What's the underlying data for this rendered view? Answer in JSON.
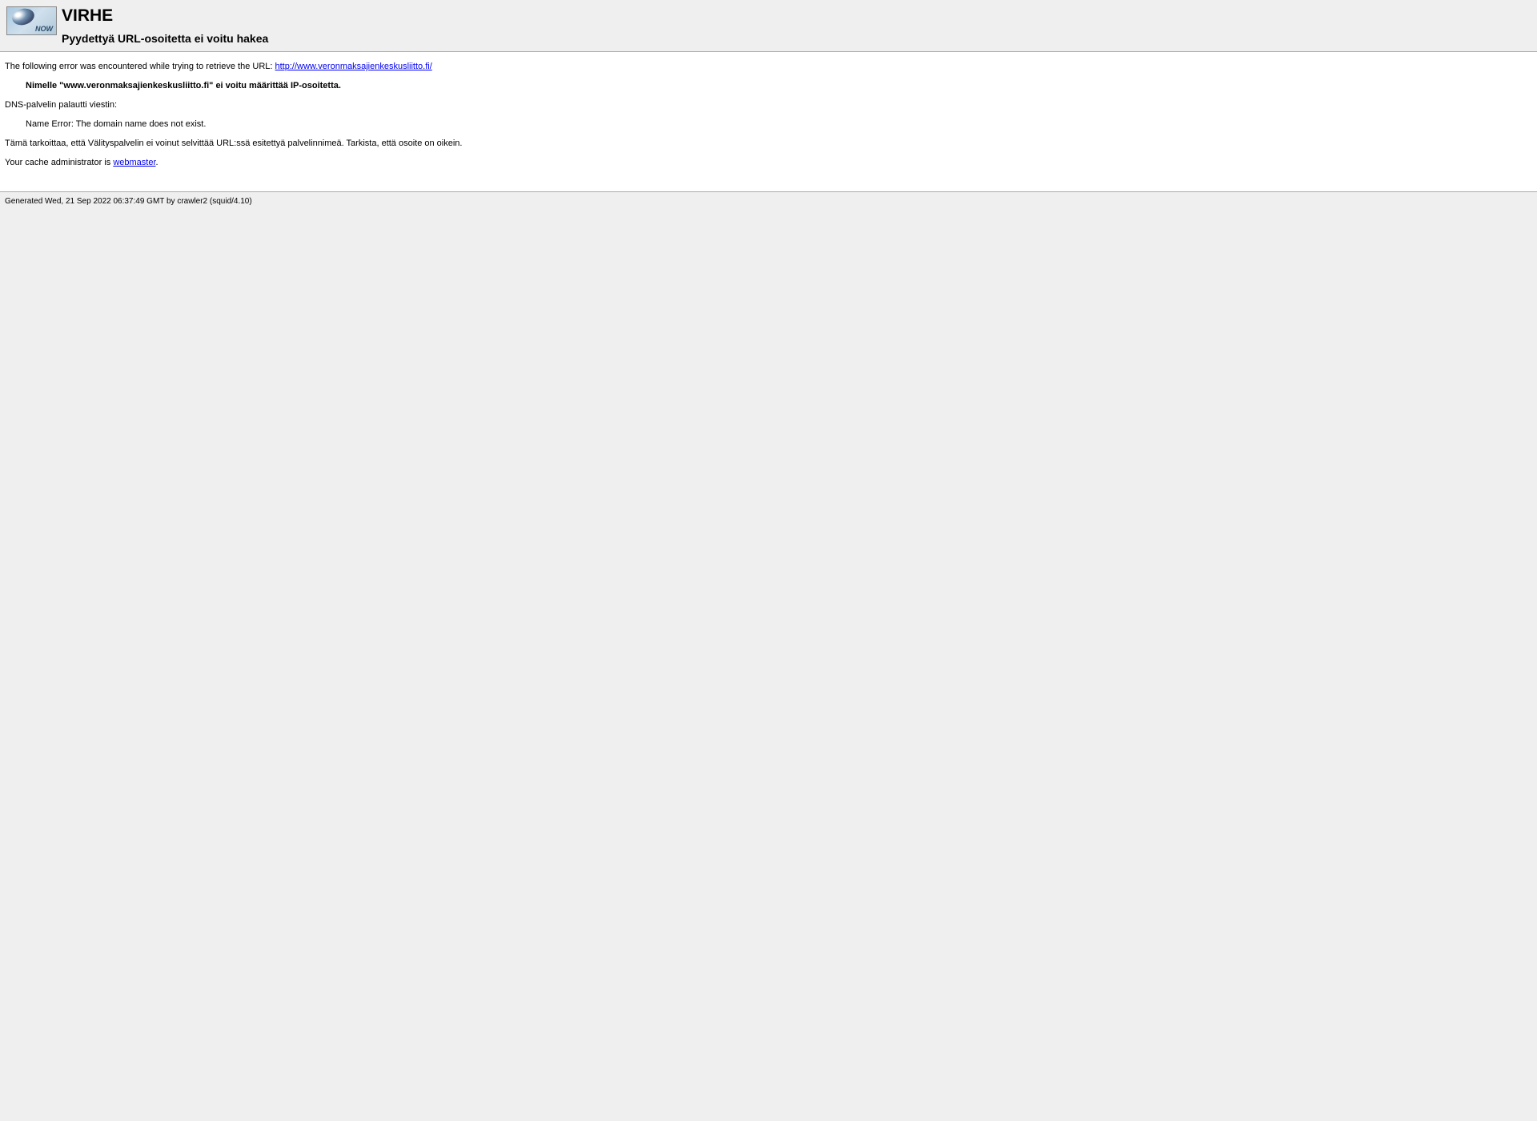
{
  "header": {
    "icon_label": "NOW",
    "title": "VIRHE",
    "subtitle": "Pyydettyä URL-osoitetta ei voitu hakea"
  },
  "content": {
    "intro_text": "The following error was encountered while trying to retrieve the URL: ",
    "url_link": "http://www.veronmaksajienkeskusliitto.fi/",
    "error_bold": "Nimelle \"www.veronmaksajienkeskusliitto.fi\" ei voitu määrittää IP-osoitetta.",
    "dns_message_label": "DNS-palvelin palautti viestin:",
    "dns_error": "Name Error: The domain name does not exist.",
    "explanation": "Tämä tarkoittaa, että Välityspalvelin ei voinut selvittää URL:ssä esitettyä palvelinnimeä. Tarkista, että osoite on oikein.",
    "admin_prefix": "Your cache administrator is ",
    "admin_link": "webmaster",
    "admin_suffix": "."
  },
  "footer": {
    "generated": "Generated Wed, 21 Sep 2022 06:37:49 GMT by crawler2 (squid/4.10)"
  }
}
